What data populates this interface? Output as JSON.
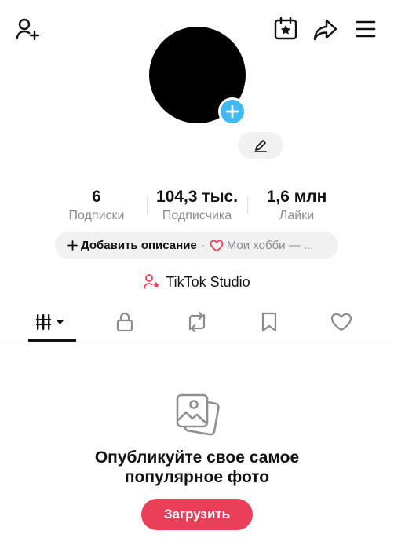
{
  "header": {
    "add_friend_icon": "person-plus-icon",
    "calendar_icon": "calendar-star-icon",
    "share_icon": "share-arrow-icon",
    "menu_icon": "hamburger-menu-icon"
  },
  "profile": {
    "avatar_add_icon": "plus-icon",
    "edit_icon": "pencil-icon"
  },
  "stats": [
    {
      "value": "6",
      "label": "Подписки"
    },
    {
      "value": "104,3 тыс.",
      "label": "Подписчика"
    },
    {
      "value": "1,6 млн",
      "label": "Лайки"
    }
  ],
  "bio": {
    "add_label": "Добавить описание",
    "separator": "·",
    "hobby_label": "Мои хобби — ..."
  },
  "studio": {
    "label": "TikTok Studio"
  },
  "tabs": [
    {
      "name": "videos",
      "icon": "grid-bars-icon"
    },
    {
      "name": "private",
      "icon": "lock-icon"
    },
    {
      "name": "reposts",
      "icon": "repost-icon"
    },
    {
      "name": "favorites",
      "icon": "bookmark-icon"
    },
    {
      "name": "liked",
      "icon": "heart-icon"
    }
  ],
  "empty_state": {
    "icon": "photos-icon",
    "title_line1": "Опубликуйте свое самое",
    "title_line2": "популярное фото",
    "button_label": "Загрузить"
  },
  "colors": {
    "accent": "#ea3f58",
    "avatar_plus": "#3fb9f0",
    "pill_bg": "#f1f1f2",
    "muted_text": "#8a8b91"
  }
}
